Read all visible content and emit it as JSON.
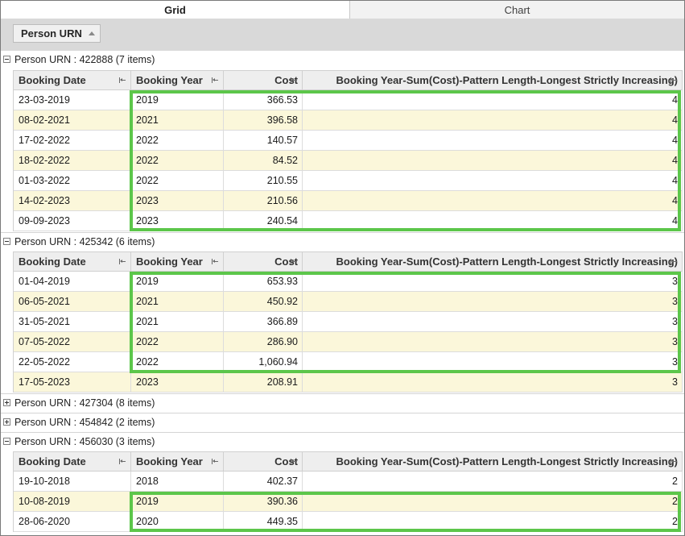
{
  "tabs": [
    {
      "label": "Grid"
    },
    {
      "label": "Chart"
    }
  ],
  "group_panel": {
    "chip_label": "Person URN"
  },
  "columns": {
    "date": "Booking Date",
    "year": "Booking Year",
    "cost": "Cost",
    "pattern": "Booking Year-Sum(Cost)-Pattern Length-Longest Strictly Increasing)"
  },
  "groups": [
    {
      "label": "Person URN : 422888 (7 items)",
      "rows": [
        {
          "date": "23-03-2019",
          "year": "2019",
          "cost": "366.53",
          "pattern": "4"
        },
        {
          "date": "08-02-2021",
          "year": "2021",
          "cost": "396.58",
          "pattern": "4"
        },
        {
          "date": "17-02-2022",
          "year": "2022",
          "cost": "140.57",
          "pattern": "4"
        },
        {
          "date": "18-02-2022",
          "year": "2022",
          "cost": "84.52",
          "pattern": "4"
        },
        {
          "date": "01-03-2022",
          "year": "2022",
          "cost": "210.55",
          "pattern": "4"
        },
        {
          "date": "14-02-2023",
          "year": "2023",
          "cost": "210.56",
          "pattern": "4"
        },
        {
          "date": "09-09-2023",
          "year": "2023",
          "cost": "240.54",
          "pattern": "4"
        }
      ]
    },
    {
      "label": "Person URN : 425342 (6 items)",
      "rows": [
        {
          "date": "01-04-2019",
          "year": "2019",
          "cost": "653.93",
          "pattern": "3"
        },
        {
          "date": "06-05-2021",
          "year": "2021",
          "cost": "450.92",
          "pattern": "3"
        },
        {
          "date": "31-05-2021",
          "year": "2021",
          "cost": "366.89",
          "pattern": "3"
        },
        {
          "date": "07-05-2022",
          "year": "2022",
          "cost": "286.90",
          "pattern": "3"
        },
        {
          "date": "22-05-2022",
          "year": "2022",
          "cost": "1,060.94",
          "pattern": "3"
        },
        {
          "date": "17-05-2023",
          "year": "2023",
          "cost": "208.91",
          "pattern": "3"
        }
      ]
    },
    {
      "label": "Person URN : 427304 (8 items)"
    },
    {
      "label": "Person URN : 454842 (2 items)"
    },
    {
      "label": "Person URN : 456030 (3 items)",
      "rows": [
        {
          "date": "19-10-2018",
          "year": "2018",
          "cost": "402.37",
          "pattern": "2"
        },
        {
          "date": "10-08-2019",
          "year": "2019",
          "cost": "390.36",
          "pattern": "2"
        },
        {
          "date": "28-06-2020",
          "year": "2020",
          "cost": "449.35",
          "pattern": "2"
        }
      ]
    }
  ],
  "colors": {
    "highlight": "#5cc64a",
    "alt_row": "#fbf7da",
    "group_panel": "#d9d9d9"
  }
}
